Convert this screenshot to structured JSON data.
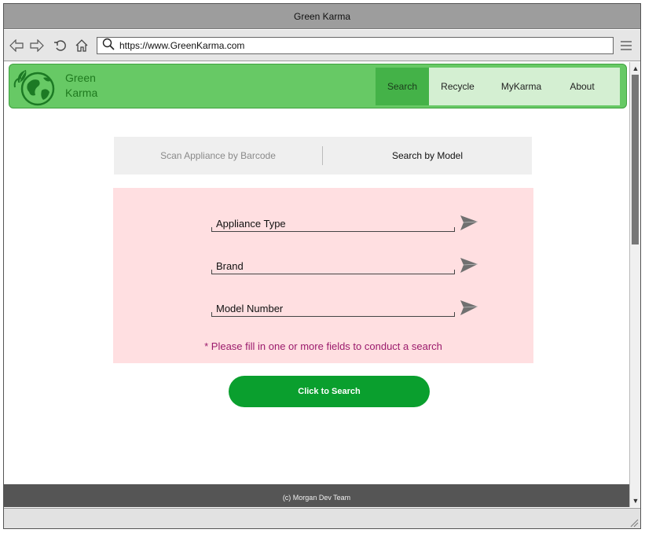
{
  "window": {
    "title": "Green Karma"
  },
  "browser": {
    "url": "https://www.GreenKarma.com"
  },
  "site": {
    "brand_line1": "Green",
    "brand_line2": "Karma",
    "nav": [
      {
        "label": "Search",
        "active": true
      },
      {
        "label": "Recycle",
        "active": false
      },
      {
        "label": "MyKarma",
        "active": false
      },
      {
        "label": "About",
        "active": false
      }
    ]
  },
  "tabs": {
    "barcode": "Scan Appliance by Barcode",
    "model": "Search by Model",
    "active": "model"
  },
  "form": {
    "fields": [
      {
        "label": "Appliance Type"
      },
      {
        "label": "Brand"
      },
      {
        "label": "Model Number"
      }
    ],
    "hint": "* Please fill in one or more fields to conduct a search"
  },
  "search_button": "Click to Search",
  "footer": "(c) Morgan Dev Team",
  "colors": {
    "header_green": "#67c965",
    "nav_active": "#44b248",
    "button_green": "#0a9f2e",
    "panel_pink": "#ffdfe1",
    "hint_magenta": "#9b1b6c"
  },
  "icons": [
    "back-arrow-icon",
    "forward-arrow-icon",
    "reload-icon",
    "home-icon",
    "search-icon",
    "menu-icon",
    "globe-leaf-icon",
    "send-icon"
  ]
}
